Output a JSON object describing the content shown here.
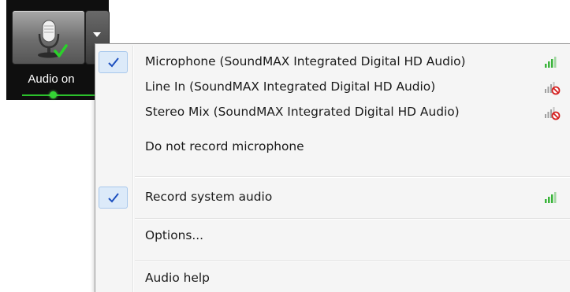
{
  "toolbar": {
    "audio_button_label": "Audio on"
  },
  "menu": {
    "items": [
      {
        "label": "Microphone (SoundMAX Integrated Digital HD Audio)",
        "checked": true,
        "signal": "active-signal-icon"
      },
      {
        "label": "Line In (SoundMAX Integrated Digital HD Audio)",
        "checked": false,
        "signal": "muted-signal-icon"
      },
      {
        "label": "Stereo Mix (SoundMAX Integrated Digital HD Audio)",
        "checked": false,
        "signal": "muted-signal-icon"
      },
      {
        "label": "Do not record microphone",
        "checked": false,
        "signal": null
      },
      {
        "label": "Record system audio",
        "checked": true,
        "signal": "active-signal-icon"
      },
      {
        "label": "Options...",
        "checked": false,
        "signal": null
      },
      {
        "label": "Audio help",
        "checked": false,
        "signal": null
      }
    ]
  },
  "colors": {
    "toolbar_bg": "#0f0f0f",
    "menu_bg": "#f5f5f5",
    "check_blue": "#1c4fbf",
    "signal_green": "#3bb43b",
    "muted_red": "#d42020"
  }
}
